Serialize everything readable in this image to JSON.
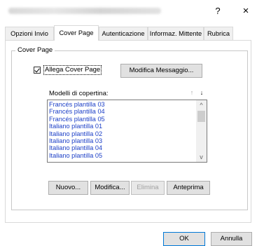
{
  "window": {
    "help_label": "?",
    "close_label": "×"
  },
  "tabs": [
    {
      "label": "Opzioni Invio"
    },
    {
      "label": "Cover Page"
    },
    {
      "label": "Autenticazione"
    },
    {
      "label": "Informaz. Mittente"
    },
    {
      "label": "Rubrica"
    }
  ],
  "cover_page": {
    "group_title": "Cover Page",
    "checkbox_label": "Allega Cover Page",
    "checkbox_checked": true,
    "edit_message_label": "Modifica Messaggio...",
    "templates_label": "Modelli di copertina:",
    "move_up_icon": "↑",
    "move_down_icon": "↓",
    "templates": [
      "Francés plantilla 03",
      "Francés plantilla 04",
      "Francés plantilla 05",
      "Italiano plantilla 01",
      "Italiano plantilla 02",
      "Italiano plantilla 03",
      "Italiano plantilla 04",
      "Italiano plantilla 05"
    ],
    "scroll_up_icon": "^",
    "scroll_down_icon": "v",
    "new_label": "Nuovo...",
    "modify_label": "Modifica...",
    "delete_label": "Elimina",
    "preview_label": "Anteprima"
  },
  "footer": {
    "ok_label": "OK",
    "cancel_label": "Annulla"
  }
}
